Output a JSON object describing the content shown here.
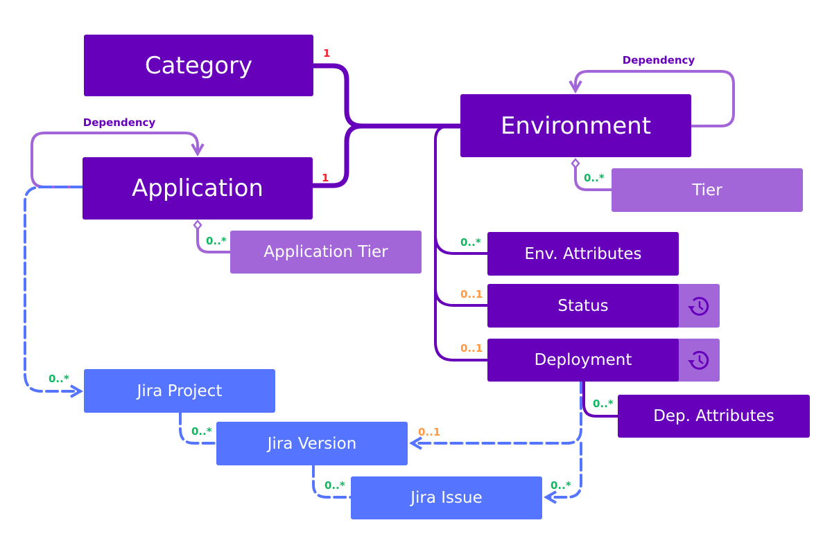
{
  "colors": {
    "entity": "#6600bb",
    "sub_entity": "#a366d8",
    "jira": "#5574ff",
    "many": "#10b860",
    "optional": "#ff9944",
    "one": "#ee2233"
  },
  "entities": {
    "category": "Category",
    "environment": "Environment",
    "application": "Application",
    "tier": "Tier",
    "application_tier": "Application Tier",
    "env_attributes": "Env. Attributes",
    "status": "Status",
    "deployment": "Deployment",
    "dep_attributes": "Dep. Attributes",
    "jira_project": "Jira Project",
    "jira_version": "Jira Version",
    "jira_issue": "Jira Issue"
  },
  "labels": {
    "dependency_env": "Dependency",
    "dependency_app": "Dependency",
    "category_mult": "1",
    "application_mult": "1",
    "tier_mult": "0..*",
    "app_tier_mult": "0..*",
    "env_attr_mult": "0..*",
    "status_mult": "0..1",
    "deployment_mult": "0..1",
    "dep_attr_mult": "0..*",
    "jira_project_mult": "0..*",
    "jira_version_mult": "0..*",
    "jira_issue_mult": "0..*",
    "deploy_version_mult": "0..1",
    "deploy_issue_mult": "0..*"
  },
  "icons": {
    "history": "history-clock-icon"
  }
}
